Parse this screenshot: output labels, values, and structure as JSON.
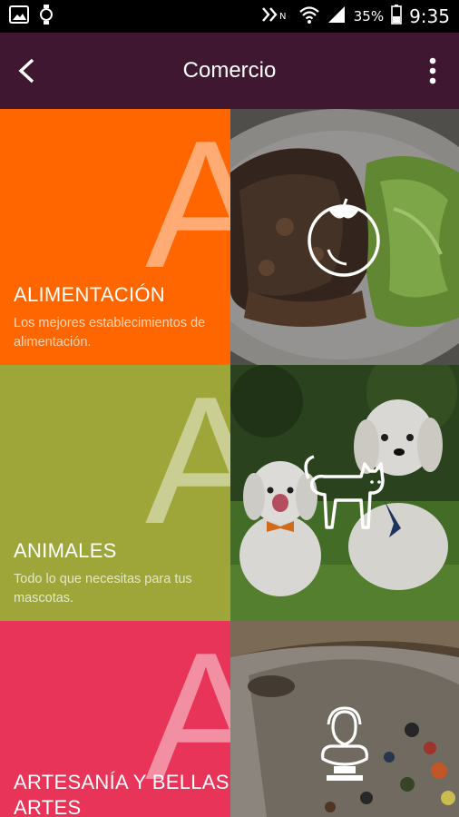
{
  "status_bar": {
    "battery_percent": "35%",
    "time": "9:35"
  },
  "app_bar": {
    "title": "Comercio",
    "back_icon": "arrow-back-icon",
    "menu_icon": "more-vert-icon"
  },
  "colors": {
    "app_bar": "#401730",
    "alimentacion": "#FF6600",
    "animales": "#9EA63A",
    "artesania": "#E83458"
  },
  "categories": [
    {
      "letter": "A",
      "title": "ALIMENTACIÓN",
      "description": "Los mejores establecimientos de alimentación.",
      "icon": "tomato-icon"
    },
    {
      "letter": "A",
      "title": "ANIMALES",
      "description": "Todo lo que necesitas para tus mascotas.",
      "icon": "cat-icon"
    },
    {
      "letter": "A",
      "title": "ARTESANÍA Y BELLAS ARTES",
      "description": "",
      "icon": "bust-statue-icon"
    }
  ]
}
